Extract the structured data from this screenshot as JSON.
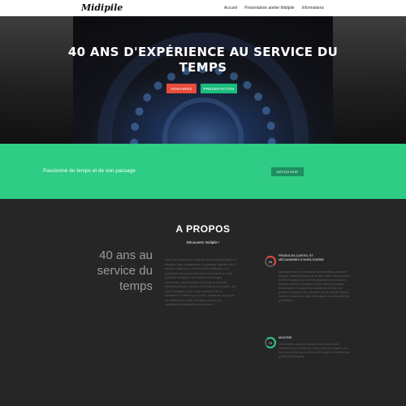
{
  "header": {
    "brand": "Midipile",
    "nav": [
      "Accueil",
      "Présentation atelier Midipile",
      "Informations"
    ]
  },
  "hero": {
    "title": "40 ANS D'EXPÉRIENCE AU SERVICE DU TEMPS",
    "btn_hours": "HORAIRES",
    "btn_presentation": "PRÉSENTATION"
  },
  "band": {
    "text": "Passionné du temps et de son passage",
    "button": "DÉCOUVRIR"
  },
  "about": {
    "title": "A PROPOS",
    "subtitle": "Découvrez midipile !",
    "quote": "40 ans au service du temps",
    "paragraph": "Tous ces travaux font l'objet de devis gratuits réalisés à domicile, sans engagement. La garantie régulière sur 2 années statiques ou constructeurs habitudes. Les professionnels parisiennes ainsi les musées de cette nouvelle horlogerie, de l'entretien d'horloges, communes, mes pendules et le plus de leurs dix dernières années, revenez vers midi pour la durée ; de votre horlogerie ou de votre pendule et de la réparation. N'hésitez pas à venir, contactez-nous pour les achats et la vente horlogerie plus de nos réparations et prestations sur-mesure.",
    "features": [
      {
        "icon_value": "95",
        "title": "PENDULES,CARTEL ET MÉCANISMES D'HORLOGERIE",
        "desc": "Spécialiste dans la restauration des pendules, pendules murales, cartels d'époque de 90 ans. Edition fait au cadran de 99 ans depuis vous permet également de nouveau à long des vôtres ou horlogers. Nous restaurons cartels, mécanismes d'horlogerie du carillonnés, montres de gousset et pendules de cheminée tout au long de l'année, service, à domicile et dans notre atelier en centre-ville des prestations."
      },
      {
        "icon_value": "75",
        "title": "MONTRE",
        "desc": "Nous traitons aussi la réparation de montres, faire l'entretien ou la révision de votre montre de poignet, tout notre savoir-faire grand service d'horlogerie en atelier pour pouvoir à l'horlogerie."
      }
    ]
  }
}
